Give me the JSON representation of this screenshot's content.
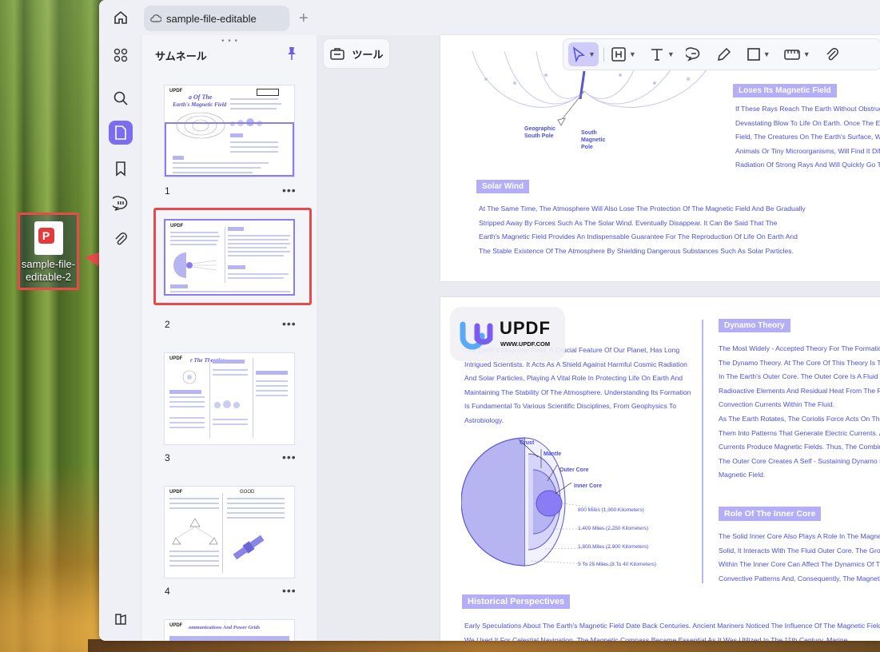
{
  "desktop": {
    "file_name_line1": "sample-file-",
    "file_name_line2": "editable-2",
    "file_badge": "P"
  },
  "window": {
    "tab_title": "sample-file-editable",
    "add_tab": "+"
  },
  "thumbnails_panel": {
    "title": "サムネール",
    "grip": "• • •",
    "pages": [
      {
        "number": "1",
        "more": "•••",
        "title": "a Of The",
        "subtitle": "Earth's Magnetic Field"
      },
      {
        "number": "2",
        "more": "•••"
      },
      {
        "number": "3",
        "more": "•••",
        "title": "r The Theories"
      },
      {
        "number": "4",
        "more": "•••",
        "title": "GOOD"
      },
      {
        "title": "ommunications And Power Grids"
      }
    ],
    "logo": "UPDF"
  },
  "toolbar": {
    "tools_label": "ツール"
  },
  "document": {
    "page1": {
      "diagram_labels": {
        "geographic": "Geographic",
        "geographic2": "South Pole",
        "south": "South",
        "south2": "Magnetic",
        "south3": "Pole"
      },
      "loses_heading": "Loses Its Magnetic Field",
      "loses_lines": [
        "If These Rays Reach The Earth Without Obstructio",
        "Devastating Blow To Life On Earth. Once The Ear",
        "Field, The Creatures On The Earth's Surface, Whe",
        "Animals Or Tiny Microorganisms, Will Find It Diffic",
        "Radiation Of Strong Rays And Will Quickly Go T"
      ],
      "solar_heading": "Solar Wind",
      "solar_lines": [
        "At The Same Time, The Atmosphere Will Also Lose The Protection Of The Magnetic Field And Be Gradually",
        "Stripped Away By Forces Such As The Solar Wind. Eventually Disappear. It Can Be Said That The",
        "Earth's Magnetic Field Provides An Indispensable Guarantee For The Reproduction Of Life On Earth And",
        "The Stable Existence Of The Atmosphere By Shielding Dangerous Substances Such As Solar Particles."
      ]
    },
    "page2": {
      "intro_lines": [
        "The Earth's Magnetic Field, A Crucial Feature Of Our Planet, Has Long",
        "Intrigued Scientists. It Acts As A Shield Against Harmful Cosmic Radiation",
        "And Solar Particles, Playing A Vital Role In Protecting Life On Earth And",
        "Maintaining The Stability Of The Atmosphere. Understanding Its Formation",
        "Is Fundamental To Various Scientific Disciplines, From Geophysics To",
        "Astrobiology."
      ],
      "layers": {
        "crust": "Crust",
        "mantle": "Mantle",
        "outer_core": "Outer Core",
        "inner_core": "Inner Core",
        "d1": "800 Miles (1,300 Kilometers)",
        "d2": "1,400 Miles (2,250 Kilometers)",
        "d3": "1,800 Miles (2,900 Kilometers)",
        "d4": "5 To 25 Miles (8 To 40 Kilometers)"
      },
      "dynamo_heading": "Dynamo Theory",
      "dynamo_lines": [
        "The Most Widely - Accepted Theory For The Formation",
        "The Dynamo Theory. At The Core Of This Theory Is The",
        "In The Earth's Outer Core. The Outer Core Is A Fluid La",
        "Radioactive Elements And Residual Heat From The Pla",
        "Convection Currents Within The Fluid.",
        "As The Earth Rotates, The Coriolis Force Acts On Thes",
        "Them Into Patterns That Generate Electric Currents. Ac",
        "Currents Produce Magnetic Fields. Thus, The Combinat",
        "The Outer Core Creates A Self - Sustaining Dynamo Pro",
        "Magnetic Field."
      ],
      "inner_heading": "Role Of The Inner Core",
      "inner_lines": [
        "The Solid Inner Core Also Plays A Role In The Magneti",
        "Solid, It Interacts With The Fluid Outer Core. The Growt",
        "Within The Inner Core Can Affect The Dynamics Of The",
        "Convective Patterns And, Consequently, The Magnetic F"
      ],
      "historical_heading": "Historical Perspectives",
      "historical_lines": [
        "Early Speculations About The Earth's Magnetic Field Date Back Centuries. Ancient Mariners Noticed The Influence Of The Magnetic Field On C",
        "We Used It For Celestial Navigation. The Magnetic Compass Became Essential As It Was Utilized In The 11th Century. Marine"
      ]
    },
    "watermark": {
      "name": "UPDF",
      "url": "WWW.UPDF.COM"
    }
  },
  "colors": {
    "accent": "#7c6cf0",
    "highlight_red": "#e64a4a",
    "doc_text": "#4b50d8",
    "heading_fill": "#b3aef5"
  }
}
